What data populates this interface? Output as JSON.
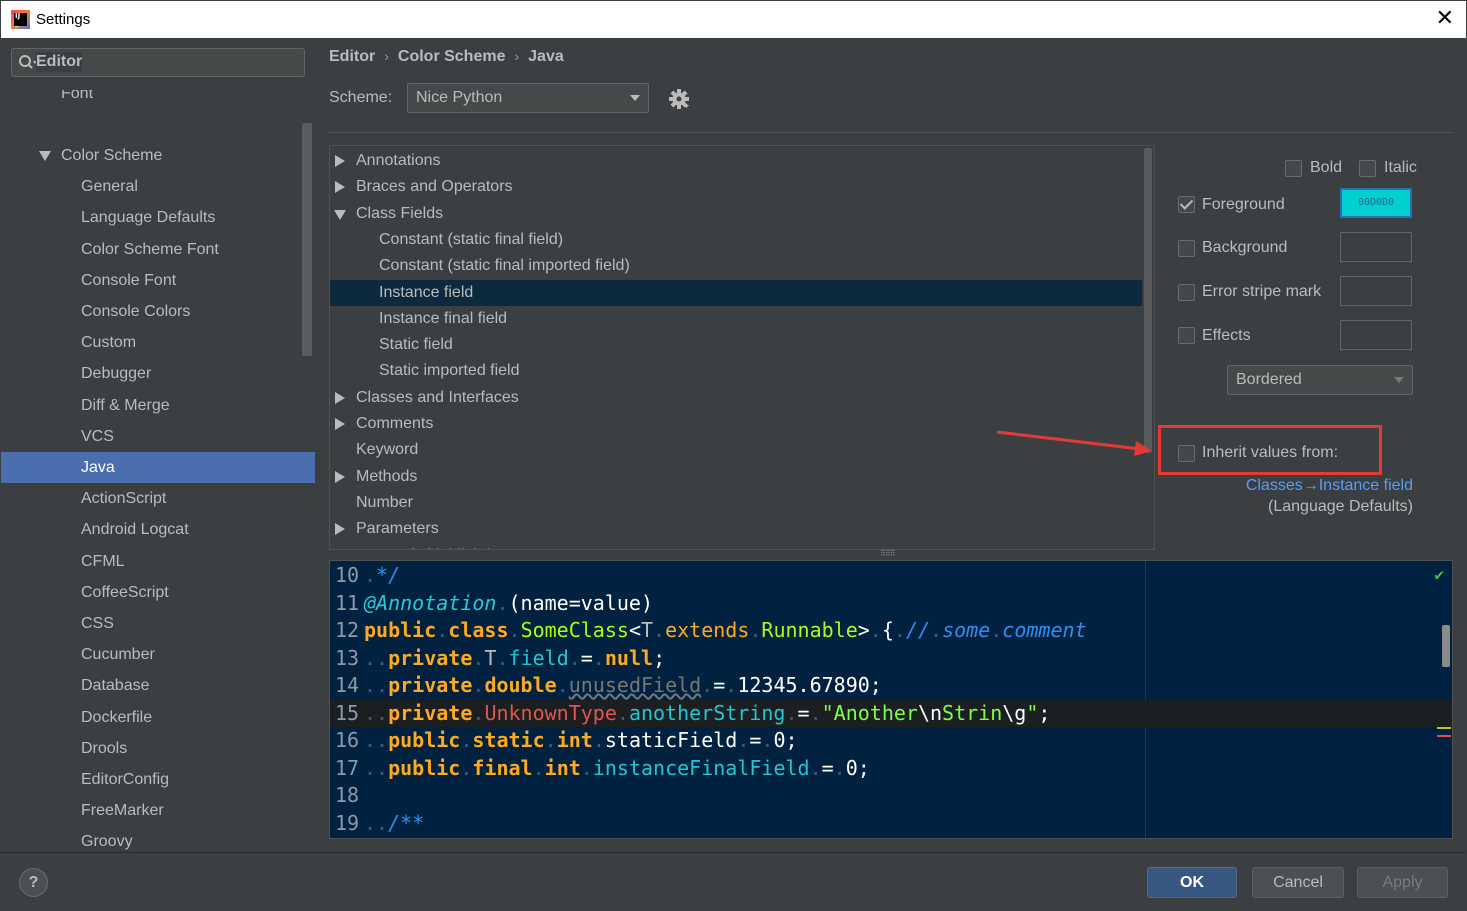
{
  "window": {
    "title": "Settings",
    "close_symbol": "✕"
  },
  "sidebar": {
    "search_placeholder": "",
    "header": "Editor",
    "items": [
      {
        "label": "Font",
        "indent": 1,
        "state": "partial"
      },
      {
        "label": "Color Scheme",
        "indent": 1,
        "expanded": true
      },
      {
        "label": "General",
        "indent": 2
      },
      {
        "label": "Language Defaults",
        "indent": 2
      },
      {
        "label": "Color Scheme Font",
        "indent": 2
      },
      {
        "label": "Console Font",
        "indent": 2
      },
      {
        "label": "Console Colors",
        "indent": 2
      },
      {
        "label": "Custom",
        "indent": 2
      },
      {
        "label": "Debugger",
        "indent": 2
      },
      {
        "label": "Diff & Merge",
        "indent": 2
      },
      {
        "label": "VCS",
        "indent": 2
      },
      {
        "label": "Java",
        "indent": 2,
        "selected": true
      },
      {
        "label": "ActionScript",
        "indent": 2
      },
      {
        "label": "Android Logcat",
        "indent": 2
      },
      {
        "label": "CFML",
        "indent": 2
      },
      {
        "label": "CoffeeScript",
        "indent": 2
      },
      {
        "label": "CSS",
        "indent": 2
      },
      {
        "label": "Cucumber",
        "indent": 2
      },
      {
        "label": "Database",
        "indent": 2
      },
      {
        "label": "Dockerfile",
        "indent": 2
      },
      {
        "label": "Drools",
        "indent": 2
      },
      {
        "label": "EditorConfig",
        "indent": 2
      },
      {
        "label": "FreeMarker",
        "indent": 2
      },
      {
        "label": "Groovy",
        "indent": 2
      }
    ]
  },
  "breadcrumb": {
    "items": [
      "Editor",
      "Color Scheme",
      "Java"
    ],
    "separator": "›"
  },
  "scheme": {
    "label": "Scheme:",
    "value": "Nice Python"
  },
  "tree": {
    "items": [
      {
        "label": "Annotations",
        "level": 0,
        "toggle": "collapsed"
      },
      {
        "label": "Braces and Operators",
        "level": 0,
        "toggle": "collapsed"
      },
      {
        "label": "Class Fields",
        "level": 0,
        "toggle": "expanded"
      },
      {
        "label": "Constant (static final field)",
        "level": 1
      },
      {
        "label": "Constant (static final imported field)",
        "level": 1
      },
      {
        "label": "Instance field",
        "level": 1,
        "selected": true
      },
      {
        "label": "Instance final field",
        "level": 1
      },
      {
        "label": "Static field",
        "level": 1
      },
      {
        "label": "Static imported field",
        "level": 1
      },
      {
        "label": "Classes and Interfaces",
        "level": 0,
        "toggle": "collapsed"
      },
      {
        "label": "Comments",
        "level": 0,
        "toggle": "collapsed"
      },
      {
        "label": "Keyword",
        "level": 0
      },
      {
        "label": "Methods",
        "level": 0,
        "toggle": "collapsed"
      },
      {
        "label": "Number",
        "level": 0
      },
      {
        "label": "Parameters",
        "level": 0,
        "toggle": "collapsed"
      },
      {
        "label": "Semantic highlighting",
        "level": 0,
        "state": "partial"
      }
    ]
  },
  "attributes": {
    "bold": {
      "label": "Bold",
      "checked": false
    },
    "italic": {
      "label": "Italic",
      "checked": false
    },
    "foreground": {
      "label": "Foreground",
      "checked": true,
      "color_text": "00D0D0",
      "color": "#00D0D0"
    },
    "background": {
      "label": "Background",
      "checked": false
    },
    "error_stripe": {
      "label": "Error stripe mark",
      "checked": false
    },
    "effects": {
      "label": "Effects",
      "checked": false
    },
    "effect_type": "Bordered",
    "inherit": {
      "label": "Inherit values from:",
      "checked": false,
      "link": "Classes→Instance field",
      "sub": "(Language Defaults)"
    },
    "highlight_color": "#E53935"
  },
  "code_preview": {
    "line_numbers": [
      "10",
      "11",
      "12",
      "13",
      "14",
      "15",
      "16",
      "17",
      "18",
      "19"
    ],
    "current_line": "15",
    "colors": {
      "background": "#002240",
      "keyword": "#FFA91F",
      "annotation": "#29C8D6",
      "class_name": "#A5FF1C",
      "comment": "#2F8FF0",
      "field": "#1FC8D0",
      "string": "#7FFF46",
      "unknown_type": "#E0554A"
    }
  },
  "buttons": {
    "ok": "OK",
    "cancel": "Cancel",
    "apply": "Apply",
    "help": "?"
  }
}
